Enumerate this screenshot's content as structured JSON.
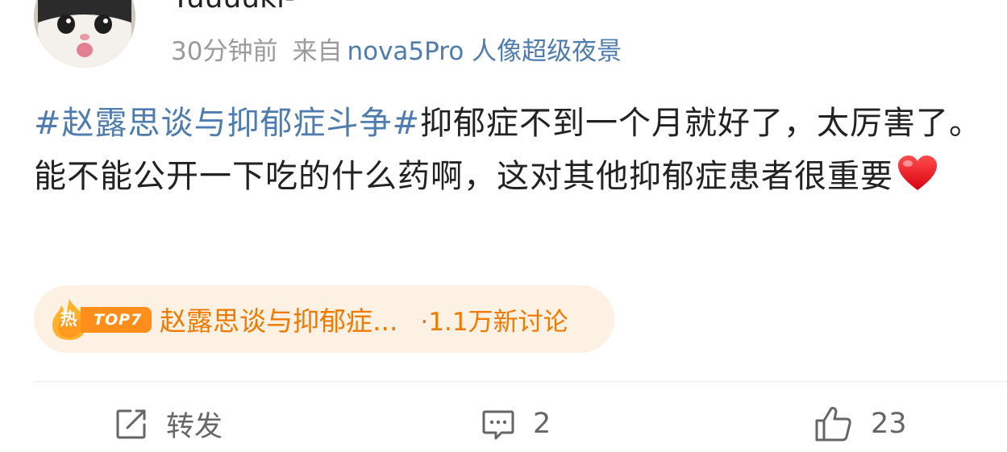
{
  "author": {
    "username": "Yuuuuki-",
    "time": "30分钟前",
    "from_label": "来自",
    "device": "nova5Pro 人像超级夜景"
  },
  "content": {
    "topic": "#赵露思谈与抑郁症斗争#",
    "text": "抑郁症不到一个月就好了，太厉害了。能不能公开一下吃的什么药啊，这对其他抑郁症患者很重要",
    "emoji_icon": "red-heart-icon"
  },
  "hot_topic": {
    "badge_char": "热",
    "rank": "TOP7",
    "title": "赵露思谈与抑郁症...",
    "count": "·1.1万新讨论",
    "color": "#f07a00",
    "background": "#fdf1e4"
  },
  "actions": {
    "repost": {
      "icon": "repost-icon",
      "label": "转发"
    },
    "comment": {
      "icon": "comment-icon",
      "label": "2"
    },
    "like": {
      "icon": "thumbs-up-icon",
      "label": "23"
    }
  },
  "colors": {
    "link": "#4f7cae",
    "meta": "#9a9a9a",
    "text": "#222222"
  }
}
